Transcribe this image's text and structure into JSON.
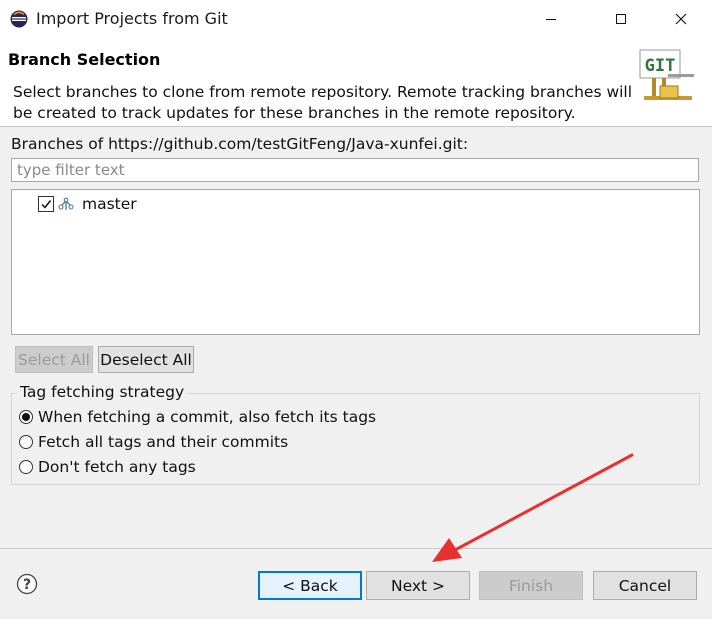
{
  "window": {
    "title": "Import Projects from Git",
    "app_icon": "eclipse-icon"
  },
  "header": {
    "title": "Branch Selection",
    "description": "Select branches to clone from remote repository. Remote tracking branches will be created to track updates for these branches in the remote repository.",
    "banner_icon": "git-banner-icon",
    "banner_text": "GIT"
  },
  "branches": {
    "label": "Branches of https://github.com/testGitFeng/Java-xunfei.git:",
    "filter_placeholder": "type filter text",
    "items": [
      {
        "name": "master",
        "checked": true,
        "icon": "branch-icon"
      }
    ]
  },
  "selection_buttons": {
    "select_all": "Select All",
    "deselect_all": "Deselect All"
  },
  "tag_strategy": {
    "title": "Tag fetching strategy",
    "options": [
      {
        "label": "When fetching a commit, also fetch its tags",
        "selected": true
      },
      {
        "label": "Fetch all tags and their commits",
        "selected": false
      },
      {
        "label": "Don't fetch any tags",
        "selected": false
      }
    ]
  },
  "footer": {
    "help_icon": "help-icon",
    "back": "< Back",
    "next": "Next >",
    "finish": "Finish",
    "cancel": "Cancel"
  },
  "colors": {
    "accent_focus": "#0078d7",
    "annotation_arrow": "#e8312f",
    "git_banner": "#2a7a3c"
  }
}
